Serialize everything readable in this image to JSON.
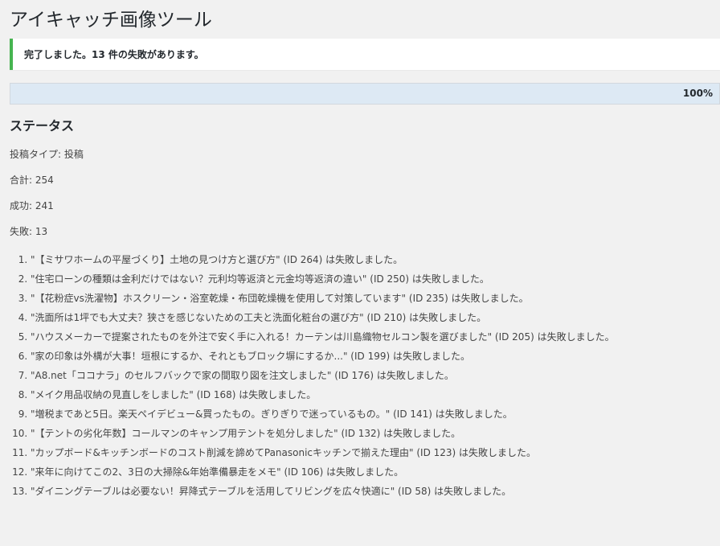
{
  "page": {
    "title": "アイキャッチ画像ツール"
  },
  "notice": {
    "message": "完了しました。13 件の失敗があります。"
  },
  "progress": {
    "value": 100,
    "label": "100%"
  },
  "status": {
    "heading": "ステータス",
    "post_type": "投稿タイプ: 投稿",
    "total": "合計: 254",
    "success": "成功: 241",
    "failed": "失敗: 13"
  },
  "failures": [
    "\"【ミサワホームの平屋づくり】土地の見つけ方と選び方\" (ID 264) は失敗しました。",
    "\"住宅ローンの種類は金利だけではない？元利均等返済と元金均等返済の違い\" (ID 250) は失敗しました。",
    "\"【花粉症vs洗濯物】ホスクリーン・浴室乾燥・布団乾燥機を使用して対策しています\" (ID 235) は失敗しました。",
    "\"洗面所は1坪でも大丈夫？狭さを感じないための工夫と洗面化粧台の選び方\" (ID 210) は失敗しました。",
    "\"ハウスメーカーで提案されたものを外注で安く手に入れる！カーテンは川島織物セルコン製を選びました\" (ID 205) は失敗しました。",
    "\"家の印象は外構が大事！垣根にするか、それともブロック塀にするか...\" (ID 199) は失敗しました。",
    "\"A8.net「ココナラ」のセルフバックで家の間取り図を注文しました\" (ID 176) は失敗しました。",
    "\"メイク用品収納の見直しをしました\" (ID 168) は失敗しました。",
    "\"増税まであと5日。楽天ペイデビュー&買ったもの。ぎりぎりで迷っているもの。\" (ID 141) は失敗しました。",
    "\"【テントの劣化年数】コールマンのキャンプ用テントを処分しました\" (ID 132) は失敗しました。",
    "\"カップボード&キッチンボードのコスト削減を諦めてPanasonicキッチンで揃えた理由\" (ID 123) は失敗しました。",
    "\"来年に向けてこの2、3日の大掃除&年始準備暴走をメモ\" (ID 106) は失敗しました。",
    "\"ダイニングテーブルは必要ない！昇降式テーブルを活用してリビングを広々快適に\" (ID 58) は失敗しました。"
  ],
  "colors": {
    "notice_border": "#46b450",
    "progress_fill": "#dde9f4",
    "background": "#f1f1f1"
  }
}
